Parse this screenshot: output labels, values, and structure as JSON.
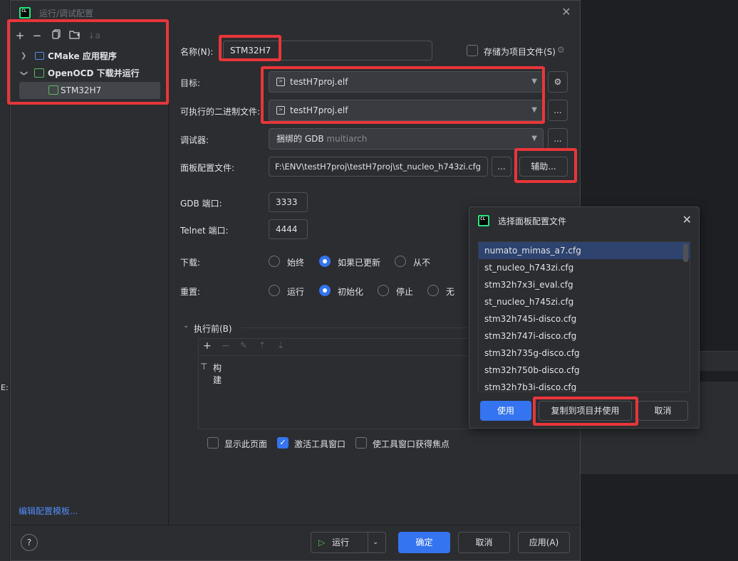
{
  "dialog": {
    "title": "运行/调试配置",
    "logo": "CL"
  },
  "sidebar": {
    "tree": [
      {
        "label": "CMake 应用程序"
      },
      {
        "label": "OpenOCD 下载并运行"
      },
      {
        "label": "STM32H7"
      }
    ],
    "edit_templates": "编辑配置模板..."
  },
  "form": {
    "name_label": "名称(N):",
    "name_value": "STM32H7",
    "store_label": "存储为项目文件(S)",
    "target_label": "目标:",
    "target_value": "testH7proj.elf",
    "executable_label": "可执行的二进制文件:",
    "executable_value": "testH7proj.elf",
    "debugger_label": "调试器:",
    "debugger_value": "捆绑的 GDB",
    "debugger_suffix": "multiarch",
    "board_label": "面板配置文件:",
    "board_value": "F:\\ENV\\testH7proj\\testH7proj\\st_nucleo_h743zi.cfg",
    "assist_label": "辅助...",
    "ellipsis": "...",
    "gdb_port_label": "GDB 端口:",
    "gdb_port_value": "3333",
    "telnet_port_label": "Telnet 端口:",
    "telnet_port_value": "4444",
    "download_label": "下载:",
    "download_options": [
      "始终",
      "如果已更新",
      "从不"
    ],
    "reset_label": "重置:",
    "reset_options": [
      "运行",
      "初始化",
      "停止",
      "无"
    ],
    "before_launch_label": "执行前(B)",
    "before_launch_items": [
      "构建"
    ],
    "show_page_label": "显示此页面",
    "activate_tool_label": "激活工具窗口",
    "focus_tool_label": "使工具窗口获得焦点"
  },
  "footer": {
    "help": "?",
    "run": "运行",
    "ok": "确定",
    "cancel": "取消",
    "apply": "应用(A)"
  },
  "popup": {
    "title": "选择面板配置文件",
    "files": [
      "numato_mimas_a7.cfg",
      "st_nucleo_h743zi.cfg",
      "stm32h7x3i_eval.cfg",
      "st_nucleo_h745zi.cfg",
      "stm32h745i-disco.cfg",
      "stm32h747i-disco.cfg",
      "stm32h735g-disco.cfg",
      "stm32h750b-disco.cfg",
      "stm32h7b3i-disco.cfg"
    ],
    "use": "使用",
    "copy_use": "复制到项目并使用",
    "cancel": "取消"
  },
  "background": {
    "edge_text": "E:"
  },
  "colors": {
    "accent": "#3574f0",
    "highlight": "#e8363a",
    "bg": "#2b2d30"
  }
}
